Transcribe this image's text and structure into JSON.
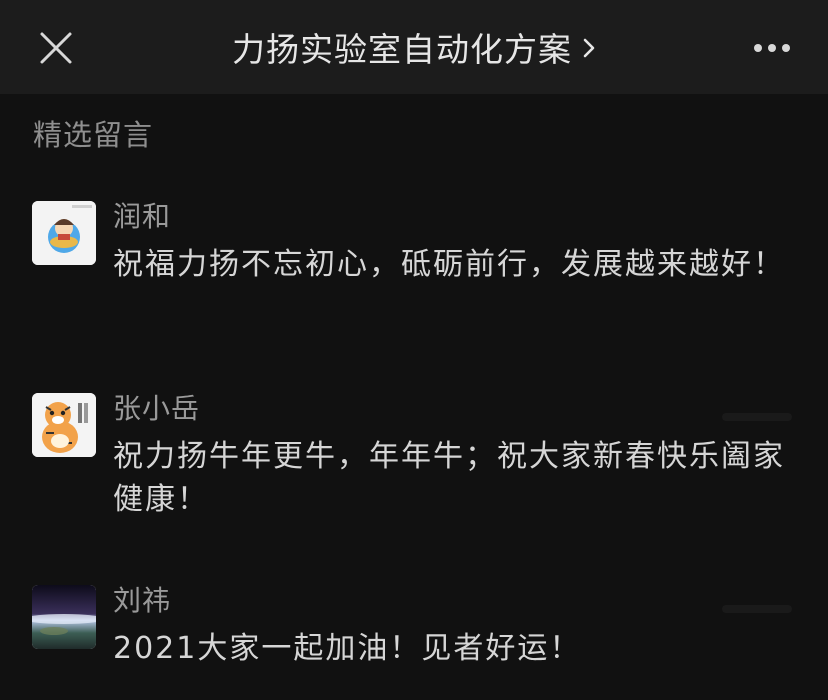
{
  "header": {
    "title": "力扬实验室自动化方案",
    "chevron_icon": "chevron-right-icon",
    "close_icon": "close-icon",
    "more_icon": "more-dots-icon"
  },
  "section": {
    "title": "精选留言"
  },
  "comments": [
    {
      "nickname": "润和",
      "content": "祝福力扬不忘初心，砥砺前行，发展越来越好！",
      "avatar_icon": "cartoon-avatar"
    },
    {
      "nickname": "张小岳",
      "content": "祝力扬牛年更牛，年年牛；祝大家新春快乐阖家健康！",
      "avatar_icon": "tiger-avatar"
    },
    {
      "nickname": "刘祎",
      "content": "2021大家一起加油！见者好运！",
      "avatar_icon": "earth-photo-avatar"
    }
  ],
  "colors": {
    "background": "#111111",
    "header_bg": "#1c1c1c",
    "title_text": "#e6e6e6",
    "secondary_text": "#9a9a9a",
    "body_text": "#d6d6d6"
  }
}
